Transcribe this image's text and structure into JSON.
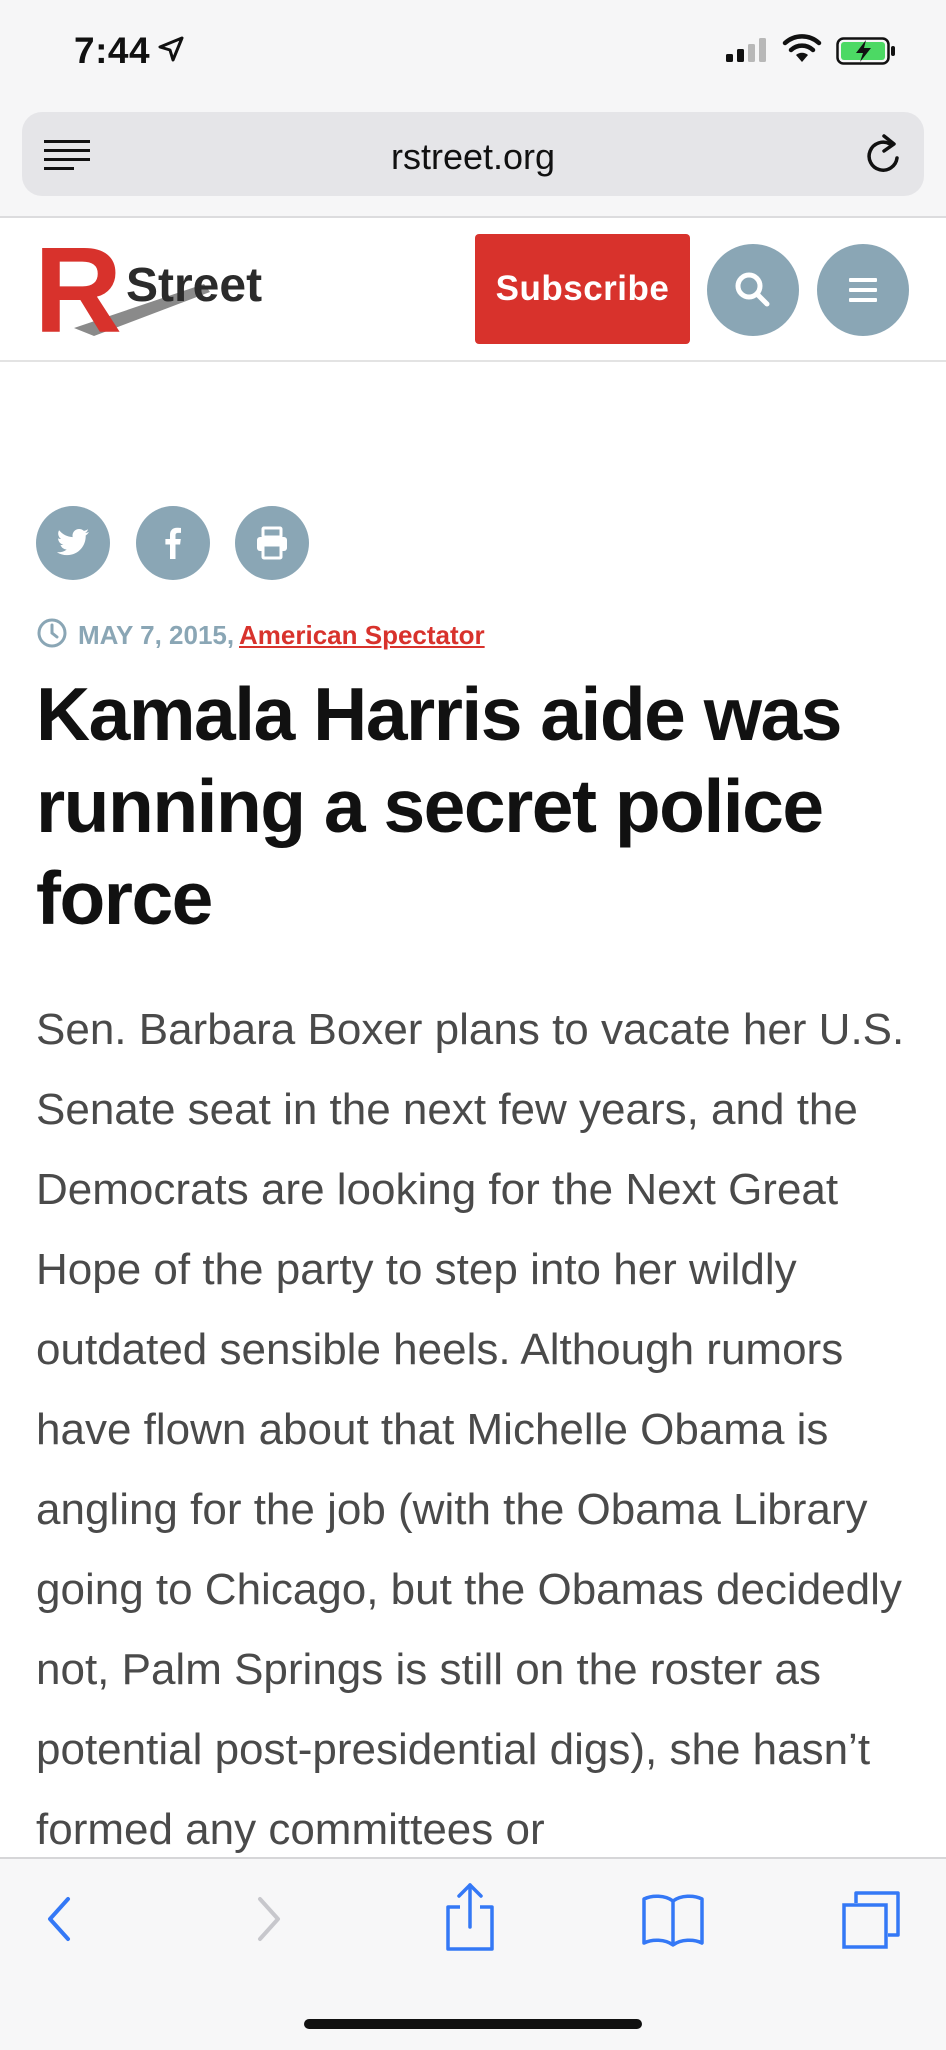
{
  "status_bar": {
    "time": "7:44",
    "icons": [
      "location-arrow-icon",
      "cellular-signal-icon",
      "wifi-icon",
      "battery-charging-icon"
    ]
  },
  "browser": {
    "url": "rstreet.org",
    "icons": [
      "reader-mode-icon",
      "reload-icon"
    ]
  },
  "site_header": {
    "logo_letter": "R",
    "logo_text": "Street",
    "subscribe_label": "Subscribe",
    "icons": [
      "search-icon",
      "hamburger-menu-icon"
    ],
    "accent_color": "#d8322c",
    "icon_circle_color": "#8aa6b5"
  },
  "share": {
    "icons": [
      "twitter-icon",
      "facebook-icon",
      "print-icon"
    ]
  },
  "article": {
    "date": "MAY 7, 2015,",
    "source": "American Spectator",
    "headline": "Kamala Harris aide was running a secret police force",
    "body": "Sen. Barbara Boxer plans to vacate her U.S. Senate seat in the next few years, and the Democrats are looking for the Next Great Hope of the party to step into her wildly outdated sensible heels. Although rumors have flown about that Michelle Obama is angling for the job (with the Obama Library going to Chicago, but the Obamas decidedly not, Palm Springs is still on the roster as potential post-presidential digs), she hasn’t formed any committees or"
  },
  "toolbar": {
    "icons": [
      "back-icon",
      "forward-icon",
      "share-icon",
      "bookmarks-icon",
      "tabs-icon"
    ],
    "tint_color": "#3478f6"
  }
}
